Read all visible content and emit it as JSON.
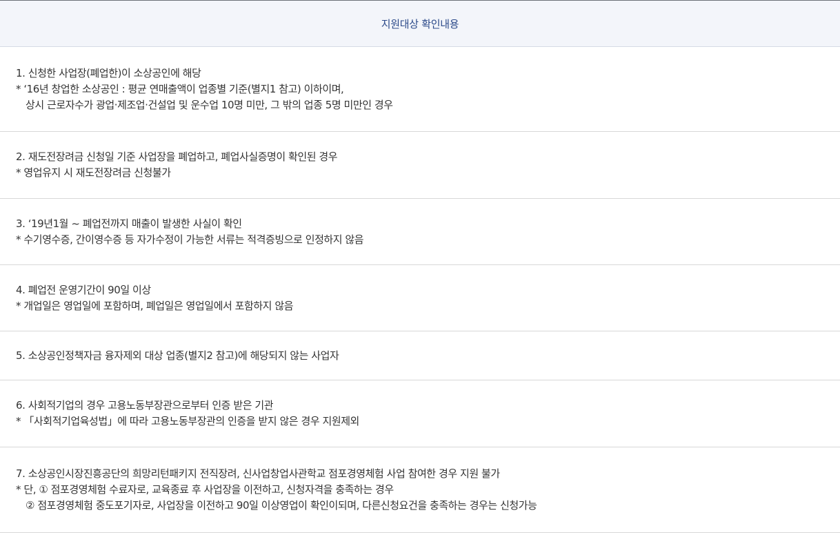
{
  "header": {
    "title": "지원대상 확인내용"
  },
  "items": [
    {
      "lines": [
        "1. 신청한 사업장(폐업한)이 소상공인에 해당",
        "* ‘16년 창업한 소상공인 : 평균 연매출액이 업종별 기준(별지1 참고) 이하이며,",
        "상시 근로자수가 광업·제조업·건설업 및 운수업 10명 미만, 그 밖의 업종 5명 미만인 경우"
      ]
    },
    {
      "lines": [
        "2. 재도전장려금 신청일 기준 사업장을 폐업하고, 폐업사실증명이 확인된 경우",
        "* 영업유지 시 재도전장려금 신청불가"
      ]
    },
    {
      "lines": [
        "3. ‘19년1월 ~ 폐업전까지 매출이 발생한 사실이 확인",
        "* 수기영수증, 간이영수증 등 자가수정이 가능한 서류는 적격증빙으로 인정하지 않음"
      ]
    },
    {
      "lines": [
        "4. 폐업전 운영기간이 90일 이상",
        "* 개업일은 영업일에 포함하며, 폐업일은 영업일에서 포함하지 않음"
      ]
    },
    {
      "lines": [
        "5. 소상공인정책자금 융자제외 대상 업종(별지2 참고)에 해당되지 않는 사업자"
      ]
    },
    {
      "lines": [
        "6. 사회적기업의 경우 고용노동부장관으로부터 인증 받은 기관",
        "* 「사회적기업육성법」에 따라 고용노동부장관의 인증을 받지 않은 경우 지원제외"
      ]
    },
    {
      "lines": [
        "7. 소상공인시장진흥공단의 희망리턴패키지 전직장려, 신사업창업사관학교 점포경영체험 사업 참여한 경우 지원 불가",
        "* 단, ① 점포경영체험 수료자로, 교육종료 후 사업장을 이전하고, 신청자격을 충족하는 경우",
        "② 점포경영체험 중도포기자로, 사업장을 이전하고 90일 이상영업이 확인이되며, 다른신청요건을 충족하는 경우는 신청가능"
      ]
    }
  ]
}
